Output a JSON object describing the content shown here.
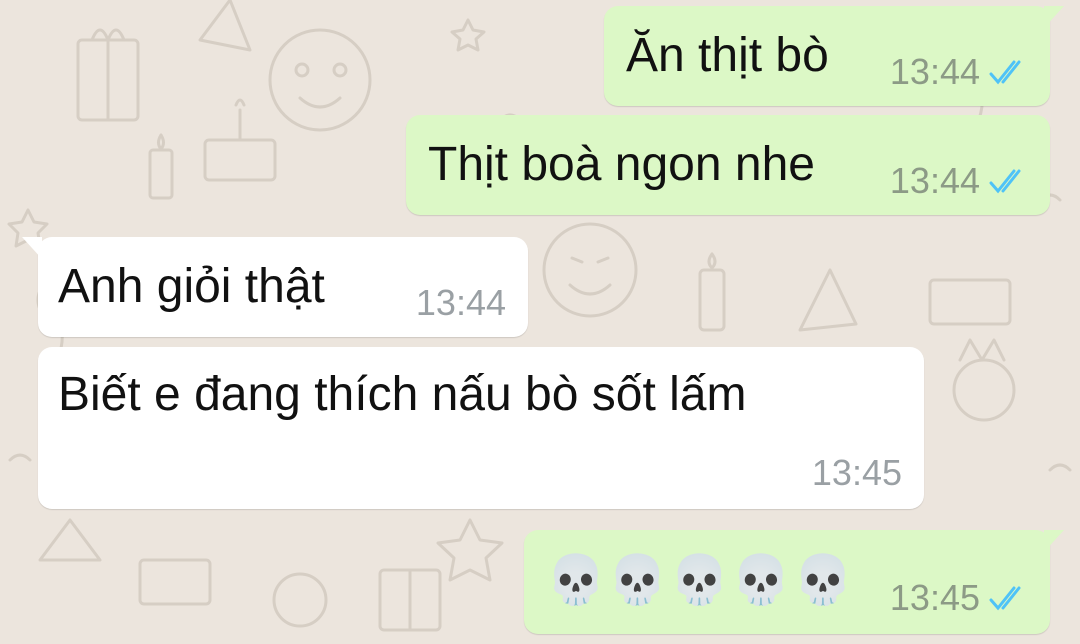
{
  "colors": {
    "wallpaper": "#ece5dd",
    "outgoing_bubble": "#dcf8c6",
    "incoming_bubble": "#ffffff",
    "read_ticks": "#4fc3f7",
    "timestamp": "#8c9a86"
  },
  "messages": [
    {
      "direction": "outgoing",
      "text": "Ăn thịt bò",
      "time": "13:44",
      "status": "read",
      "status_icon": "double-check-read-icon"
    },
    {
      "direction": "outgoing",
      "text": "Thịt boà ngon nhe",
      "time": "13:44",
      "status": "read",
      "status_icon": "double-check-read-icon"
    },
    {
      "direction": "incoming",
      "text": "Anh giỏi thật",
      "time": "13:44"
    },
    {
      "direction": "incoming",
      "text": "Biết e đang thích nấu bò sốt lấm",
      "time": "13:45"
    },
    {
      "direction": "outgoing",
      "text": "💀💀💀💀💀",
      "time": "13:45",
      "status": "read",
      "status_icon": "double-check-read-icon"
    }
  ]
}
